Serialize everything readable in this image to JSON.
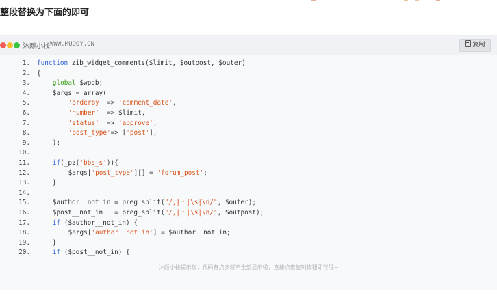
{
  "heading": "整段替换为下面的即可",
  "codebox": {
    "site_name": "沐颜小栈",
    "site_url": "WWW.MUOOY.CN",
    "copy_label": "复制",
    "dots": [
      "#ee5f57",
      "#f5bd2e",
      "#36c73f"
    ],
    "lines": [
      {
        "n": "1.",
        "i": 0,
        "t": [
          [
            "function",
            "k"
          ],
          [
            " zib_widget_comments($limit, $outpost, $outer)",
            "p"
          ]
        ]
      },
      {
        "n": "2.",
        "i": 0,
        "t": [
          [
            "{",
            "p"
          ]
        ]
      },
      {
        "n": "3.",
        "i": 4,
        "t": [
          [
            "global",
            "g"
          ],
          [
            " $wpdb;",
            "p"
          ]
        ]
      },
      {
        "n": "4.",
        "i": 4,
        "t": [
          [
            "$args = array(",
            "p"
          ]
        ]
      },
      {
        "n": "5.",
        "i": 8,
        "t": [
          [
            "'orderby'",
            "s"
          ],
          [
            " => ",
            "p"
          ],
          [
            "'comment_date'",
            "s"
          ],
          [
            ",",
            "p"
          ]
        ]
      },
      {
        "n": "6.",
        "i": 8,
        "t": [
          [
            "'number'",
            "s"
          ],
          [
            "  => $limit,",
            "p"
          ]
        ]
      },
      {
        "n": "7.",
        "i": 8,
        "t": [
          [
            "'status'",
            "s"
          ],
          [
            "  => ",
            "p"
          ],
          [
            "'approve'",
            "s"
          ],
          [
            ",",
            "p"
          ]
        ]
      },
      {
        "n": "8.",
        "i": 8,
        "t": [
          [
            "'post_type'",
            "s"
          ],
          [
            "=> [",
            "p"
          ],
          [
            "'post'",
            "s"
          ],
          [
            "],",
            "p"
          ]
        ]
      },
      {
        "n": "9.",
        "i": 4,
        "t": [
          [
            ");",
            "p"
          ]
        ]
      },
      {
        "n": "10.",
        "i": 0,
        "t": []
      },
      {
        "n": "11.",
        "i": 4,
        "t": [
          [
            "if",
            "k"
          ],
          [
            "(_pz(",
            "p"
          ],
          [
            "'bbs_s'",
            "s"
          ],
          [
            ")){",
            "p"
          ]
        ]
      },
      {
        "n": "12.",
        "i": 8,
        "t": [
          [
            "$args[",
            "p"
          ],
          [
            "'post_type'",
            "s"
          ],
          [
            "][] = ",
            "p"
          ],
          [
            "'forum_post'",
            "s"
          ],
          [
            ";",
            "p"
          ]
        ]
      },
      {
        "n": "13.",
        "i": 4,
        "t": [
          [
            "}",
            "p"
          ]
        ]
      },
      {
        "n": "14.",
        "i": 0,
        "t": []
      },
      {
        "n": "15.",
        "i": 4,
        "t": [
          [
            "$author__not_in = preg_split(",
            "p"
          ],
          [
            "\"/,|・|\\s|\\n/\"",
            "s"
          ],
          [
            ", $outer);",
            "p"
          ]
        ]
      },
      {
        "n": "16.",
        "i": 4,
        "t": [
          [
            "$post__not_in   = preg_split(",
            "p"
          ],
          [
            "\"/,|・|\\s|\\n/\"",
            "s"
          ],
          [
            ", $outpost);",
            "p"
          ]
        ]
      },
      {
        "n": "17.",
        "i": 4,
        "t": [
          [
            "if",
            "k"
          ],
          [
            " ($author__not_in) {",
            "p"
          ]
        ]
      },
      {
        "n": "18.",
        "i": 8,
        "t": [
          [
            "$args[",
            "p"
          ],
          [
            "'author__not_in'",
            "s"
          ],
          [
            "] = $author__not_in;",
            "p"
          ]
        ]
      },
      {
        "n": "19.",
        "i": 4,
        "t": [
          [
            "}",
            "p"
          ]
        ]
      },
      {
        "n": "20.",
        "i": 4,
        "t": [
          [
            "if",
            "k"
          ],
          [
            " ($post__not_in) {",
            "p"
          ]
        ]
      }
    ],
    "hint": "沐颜小栈提示您：代码有点多就不全部显示啦，直接点击复制按钮即可哦~"
  }
}
